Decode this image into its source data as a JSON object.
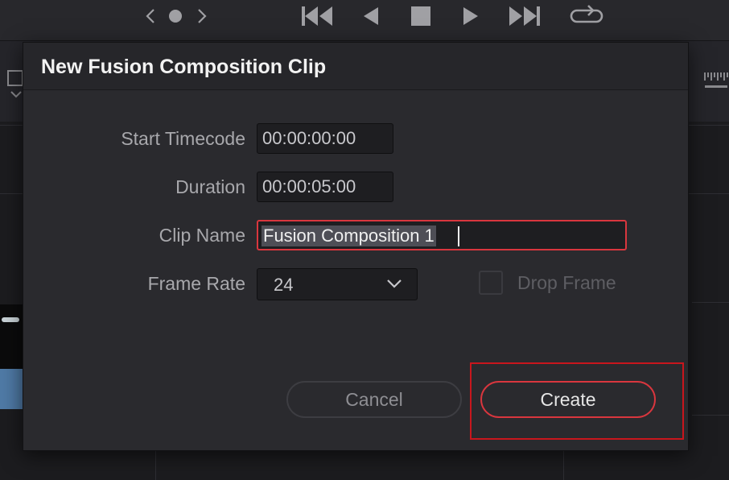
{
  "dialog": {
    "title": "New Fusion Composition Clip",
    "fields": {
      "start_timecode": {
        "label": "Start Timecode",
        "value": "00:00:00:00"
      },
      "duration": {
        "label": "Duration",
        "value": "00:00:05:00"
      },
      "clip_name": {
        "label": "Clip Name",
        "value": "Fusion Composition 1"
      },
      "frame_rate": {
        "label": "Frame Rate",
        "value": "24"
      },
      "drop_frame": {
        "label": "Drop Frame",
        "checked": false
      }
    },
    "buttons": {
      "cancel": "Cancel",
      "create": "Create"
    }
  },
  "colors": {
    "accent": "#d9363e",
    "dialog_bg": "#2a2a2e"
  },
  "icons": {
    "transport": [
      "prev-page-icon",
      "dot-icon",
      "next-page-icon",
      "skip-to-start-icon",
      "play-reverse-icon",
      "stop-icon",
      "play-icon",
      "skip-to-end-icon",
      "loop-icon"
    ]
  }
}
